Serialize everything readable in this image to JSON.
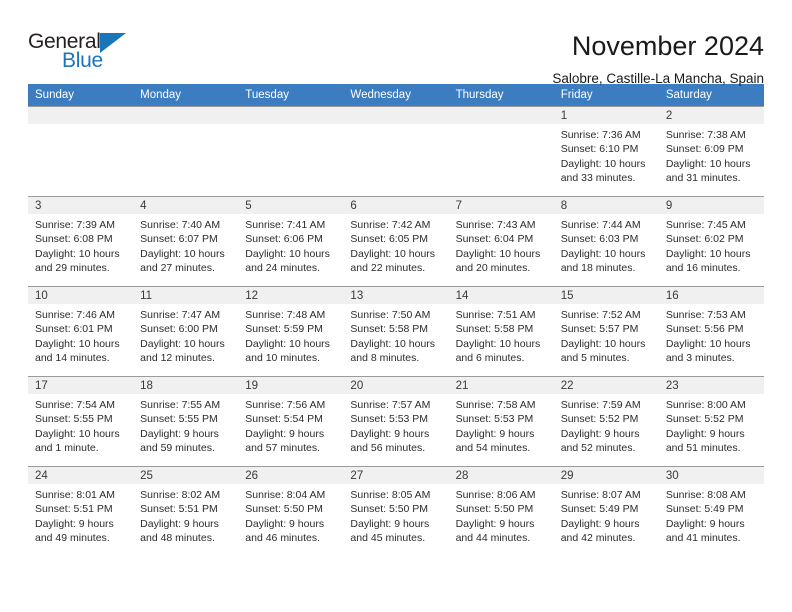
{
  "brand": {
    "name_top": "General",
    "name_bottom": "Blue",
    "triangle_color": "#1b75bb",
    "top_color": "#231f20"
  },
  "header": {
    "title": "November 2024",
    "subtitle": "Salobre, Castille-La Mancha, Spain"
  },
  "colors": {
    "header_row_bg": "#3b7dc0",
    "header_row_text": "#ffffff",
    "daynum_bg": "#f0f0f0",
    "cell_border": "#9b9b9b"
  },
  "weekdays": [
    "Sunday",
    "Monday",
    "Tuesday",
    "Wednesday",
    "Thursday",
    "Friday",
    "Saturday"
  ],
  "labels": {
    "sunrise_prefix": "Sunrise:",
    "sunset_prefix": "Sunset:",
    "daylight_prefix": "Daylight:"
  },
  "weeks": [
    [
      {
        "empty": true
      },
      {
        "empty": true
      },
      {
        "empty": true
      },
      {
        "empty": true
      },
      {
        "empty": true
      },
      {
        "day": "1",
        "sunrise": "Sunrise: 7:36 AM",
        "sunset": "Sunset: 6:10 PM",
        "daylight_1": "Daylight: 10 hours",
        "daylight_2": "and 33 minutes."
      },
      {
        "day": "2",
        "sunrise": "Sunrise: 7:38 AM",
        "sunset": "Sunset: 6:09 PM",
        "daylight_1": "Daylight: 10 hours",
        "daylight_2": "and 31 minutes."
      }
    ],
    [
      {
        "day": "3",
        "sunrise": "Sunrise: 7:39 AM",
        "sunset": "Sunset: 6:08 PM",
        "daylight_1": "Daylight: 10 hours",
        "daylight_2": "and 29 minutes."
      },
      {
        "day": "4",
        "sunrise": "Sunrise: 7:40 AM",
        "sunset": "Sunset: 6:07 PM",
        "daylight_1": "Daylight: 10 hours",
        "daylight_2": "and 27 minutes."
      },
      {
        "day": "5",
        "sunrise": "Sunrise: 7:41 AM",
        "sunset": "Sunset: 6:06 PM",
        "daylight_1": "Daylight: 10 hours",
        "daylight_2": "and 24 minutes."
      },
      {
        "day": "6",
        "sunrise": "Sunrise: 7:42 AM",
        "sunset": "Sunset: 6:05 PM",
        "daylight_1": "Daylight: 10 hours",
        "daylight_2": "and 22 minutes."
      },
      {
        "day": "7",
        "sunrise": "Sunrise: 7:43 AM",
        "sunset": "Sunset: 6:04 PM",
        "daylight_1": "Daylight: 10 hours",
        "daylight_2": "and 20 minutes."
      },
      {
        "day": "8",
        "sunrise": "Sunrise: 7:44 AM",
        "sunset": "Sunset: 6:03 PM",
        "daylight_1": "Daylight: 10 hours",
        "daylight_2": "and 18 minutes."
      },
      {
        "day": "9",
        "sunrise": "Sunrise: 7:45 AM",
        "sunset": "Sunset: 6:02 PM",
        "daylight_1": "Daylight: 10 hours",
        "daylight_2": "and 16 minutes."
      }
    ],
    [
      {
        "day": "10",
        "sunrise": "Sunrise: 7:46 AM",
        "sunset": "Sunset: 6:01 PM",
        "daylight_1": "Daylight: 10 hours",
        "daylight_2": "and 14 minutes."
      },
      {
        "day": "11",
        "sunrise": "Sunrise: 7:47 AM",
        "sunset": "Sunset: 6:00 PM",
        "daylight_1": "Daylight: 10 hours",
        "daylight_2": "and 12 minutes."
      },
      {
        "day": "12",
        "sunrise": "Sunrise: 7:48 AM",
        "sunset": "Sunset: 5:59 PM",
        "daylight_1": "Daylight: 10 hours",
        "daylight_2": "and 10 minutes."
      },
      {
        "day": "13",
        "sunrise": "Sunrise: 7:50 AM",
        "sunset": "Sunset: 5:58 PM",
        "daylight_1": "Daylight: 10 hours",
        "daylight_2": "and 8 minutes."
      },
      {
        "day": "14",
        "sunrise": "Sunrise: 7:51 AM",
        "sunset": "Sunset: 5:58 PM",
        "daylight_1": "Daylight: 10 hours",
        "daylight_2": "and 6 minutes."
      },
      {
        "day": "15",
        "sunrise": "Sunrise: 7:52 AM",
        "sunset": "Sunset: 5:57 PM",
        "daylight_1": "Daylight: 10 hours",
        "daylight_2": "and 5 minutes."
      },
      {
        "day": "16",
        "sunrise": "Sunrise: 7:53 AM",
        "sunset": "Sunset: 5:56 PM",
        "daylight_1": "Daylight: 10 hours",
        "daylight_2": "and 3 minutes."
      }
    ],
    [
      {
        "day": "17",
        "sunrise": "Sunrise: 7:54 AM",
        "sunset": "Sunset: 5:55 PM",
        "daylight_1": "Daylight: 10 hours",
        "daylight_2": "and 1 minute."
      },
      {
        "day": "18",
        "sunrise": "Sunrise: 7:55 AM",
        "sunset": "Sunset: 5:55 PM",
        "daylight_1": "Daylight: 9 hours",
        "daylight_2": "and 59 minutes."
      },
      {
        "day": "19",
        "sunrise": "Sunrise: 7:56 AM",
        "sunset": "Sunset: 5:54 PM",
        "daylight_1": "Daylight: 9 hours",
        "daylight_2": "and 57 minutes."
      },
      {
        "day": "20",
        "sunrise": "Sunrise: 7:57 AM",
        "sunset": "Sunset: 5:53 PM",
        "daylight_1": "Daylight: 9 hours",
        "daylight_2": "and 56 minutes."
      },
      {
        "day": "21",
        "sunrise": "Sunrise: 7:58 AM",
        "sunset": "Sunset: 5:53 PM",
        "daylight_1": "Daylight: 9 hours",
        "daylight_2": "and 54 minutes."
      },
      {
        "day": "22",
        "sunrise": "Sunrise: 7:59 AM",
        "sunset": "Sunset: 5:52 PM",
        "daylight_1": "Daylight: 9 hours",
        "daylight_2": "and 52 minutes."
      },
      {
        "day": "23",
        "sunrise": "Sunrise: 8:00 AM",
        "sunset": "Sunset: 5:52 PM",
        "daylight_1": "Daylight: 9 hours",
        "daylight_2": "and 51 minutes."
      }
    ],
    [
      {
        "day": "24",
        "sunrise": "Sunrise: 8:01 AM",
        "sunset": "Sunset: 5:51 PM",
        "daylight_1": "Daylight: 9 hours",
        "daylight_2": "and 49 minutes."
      },
      {
        "day": "25",
        "sunrise": "Sunrise: 8:02 AM",
        "sunset": "Sunset: 5:51 PM",
        "daylight_1": "Daylight: 9 hours",
        "daylight_2": "and 48 minutes."
      },
      {
        "day": "26",
        "sunrise": "Sunrise: 8:04 AM",
        "sunset": "Sunset: 5:50 PM",
        "daylight_1": "Daylight: 9 hours",
        "daylight_2": "and 46 minutes."
      },
      {
        "day": "27",
        "sunrise": "Sunrise: 8:05 AM",
        "sunset": "Sunset: 5:50 PM",
        "daylight_1": "Daylight: 9 hours",
        "daylight_2": "and 45 minutes."
      },
      {
        "day": "28",
        "sunrise": "Sunrise: 8:06 AM",
        "sunset": "Sunset: 5:50 PM",
        "daylight_1": "Daylight: 9 hours",
        "daylight_2": "and 44 minutes."
      },
      {
        "day": "29",
        "sunrise": "Sunrise: 8:07 AM",
        "sunset": "Sunset: 5:49 PM",
        "daylight_1": "Daylight: 9 hours",
        "daylight_2": "and 42 minutes."
      },
      {
        "day": "30",
        "sunrise": "Sunrise: 8:08 AM",
        "sunset": "Sunset: 5:49 PM",
        "daylight_1": "Daylight: 9 hours",
        "daylight_2": "and 41 minutes."
      }
    ]
  ]
}
